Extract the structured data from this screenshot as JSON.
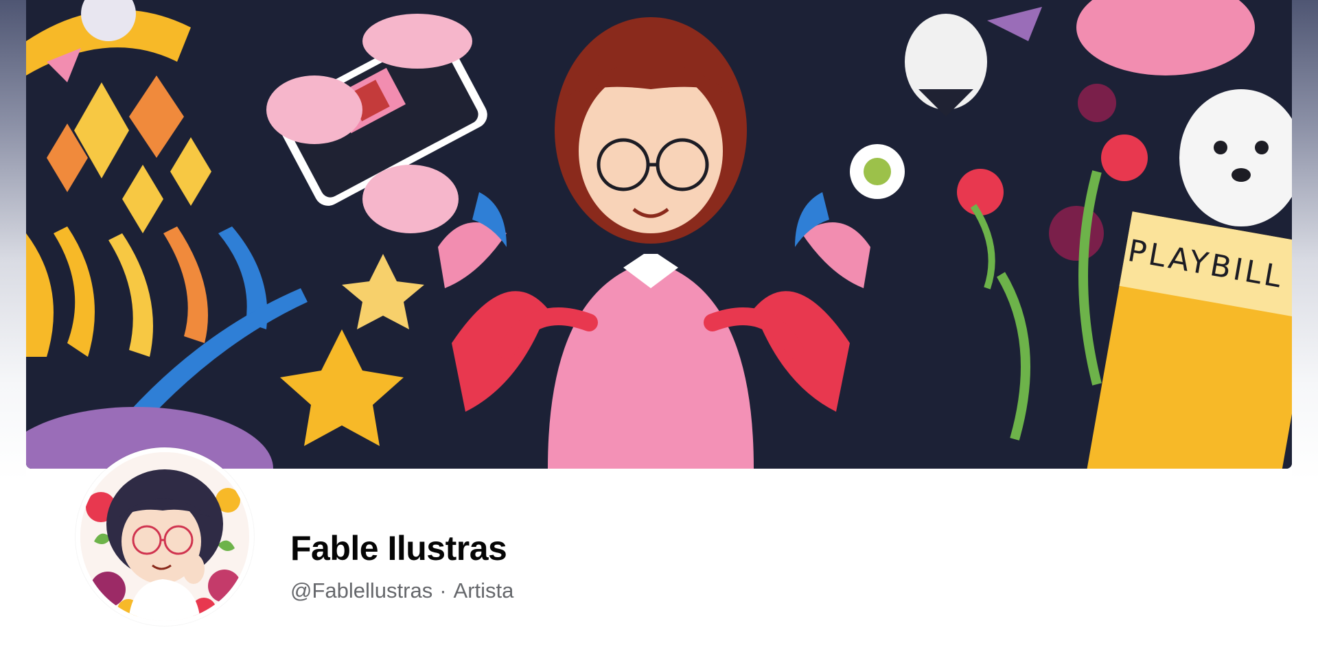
{
  "profile": {
    "name": "Fable Ilustras",
    "handle": "@Fablellustras",
    "separator": "·",
    "category": "Artista"
  },
  "cover": {
    "text_on_cover": "PLAYBILL"
  },
  "colors": {
    "name_text": "#050505",
    "secondary_text": "#65676b",
    "cover_background": "#1c2136",
    "accent_pink": "#f28db0",
    "accent_yellow": "#f7b928",
    "accent_red": "#e8384f"
  }
}
